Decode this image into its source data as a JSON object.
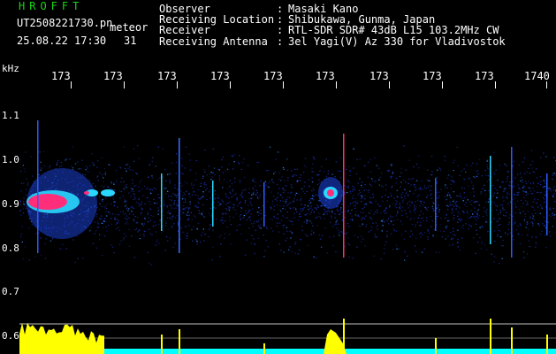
{
  "header": {
    "app_title": "HROFFT",
    "filename": "UT2508221730.pn",
    "mode": "meteor",
    "datetime": "25.08.22 17:30",
    "count": "31"
  },
  "info": {
    "rows": [
      {
        "label": "Observer",
        "value": "Masaki Kano"
      },
      {
        "label": "Receiving Location",
        "value": "Shibukawa, Gunma, Japan"
      },
      {
        "label": "Receiver",
        "value": "RTL-SDR SDR# 43dB L15 103.2MHz CW"
      },
      {
        "label": "Receiving Antenna",
        "value": "3el Yagi(V) Az 330 for Vladivostok"
      }
    ],
    "colon": ":"
  },
  "axes": {
    "y_unit": "kHz",
    "y_ticks": [
      "1.1",
      "1.0",
      "0.9",
      "0.8",
      "0.7",
      "0.6"
    ],
    "x_ticks": [
      "173",
      "173",
      "173",
      "173",
      "173",
      "173",
      "173",
      "173",
      "173",
      "1740"
    ]
  },
  "colors": {
    "noise": "#1a2fb0",
    "echo_hot": "#ff2d7a",
    "echo_mid": "#2ad8ff",
    "power": "#ffff00",
    "baseline": "#00ffff",
    "text_green": "#19d419"
  }
}
